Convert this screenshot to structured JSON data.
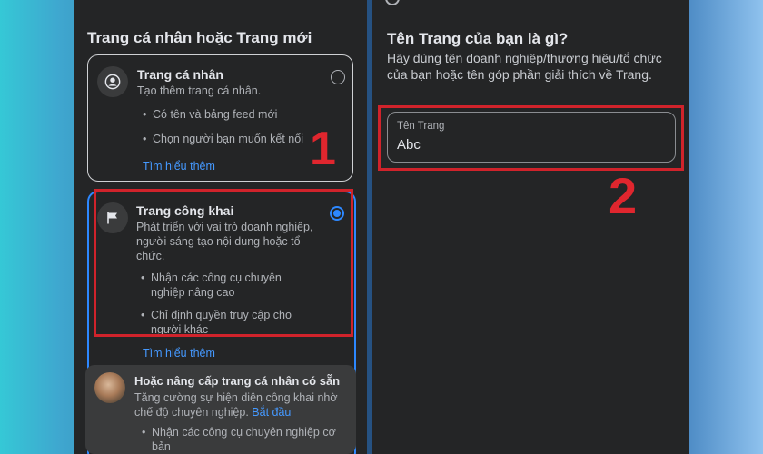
{
  "left": {
    "heading": "Trang cá nhân hoặc Trang mới",
    "personal": {
      "title": "Trang cá nhân",
      "subtitle": "Tạo thêm trang cá nhân.",
      "bullets": [
        "Có tên và bảng feed mới",
        "Chọn người bạn muốn kết nối"
      ],
      "link": "Tìm hiểu thêm",
      "selected": false
    },
    "public": {
      "title": "Trang công khai",
      "subtitle": "Phát triển với vai trò doanh nghiệp, người sáng tạo nội dung hoặc tổ chức.",
      "bullets": [
        "Nhận các công cụ chuyên nghiệp nâng cao",
        "Chỉ định quyền truy cập cho người khác"
      ],
      "link": "Tìm hiểu thêm",
      "selected": true
    },
    "upgrade": {
      "title": "Hoặc nâng cấp trang cá nhân có sẵn",
      "desc": "Tăng cường sự hiện diện công khai nhờ chế độ chuyên nghiệp.",
      "link": "Bắt đầu",
      "bullet": "Nhận các công cụ chuyên nghiệp cơ bản"
    },
    "annotation_number": "1"
  },
  "right": {
    "title": "Tên Trang của bạn là gì?",
    "description": "Hãy dùng tên doanh nghiệp/thương hiệu/tổ chức của bạn hoặc tên góp phần giải thích về Trang.",
    "field_label": "Tên Trang",
    "field_value": "Abc",
    "annotation_number": "2"
  },
  "colors": {
    "panel_bg": "#242526",
    "accent_blue": "#2d88ff",
    "annotation_red": "#d0232b"
  },
  "icons": {
    "personal": "user-circle-icon",
    "public": "flag-icon",
    "top_search": "search-icon"
  }
}
